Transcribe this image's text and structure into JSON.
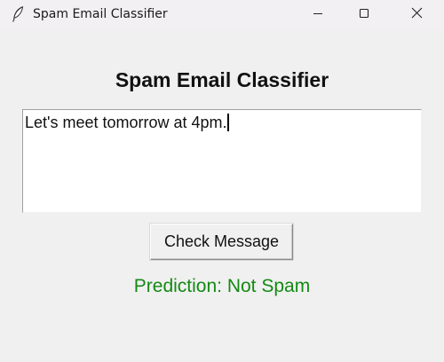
{
  "window": {
    "title": "Spam Email Classifier",
    "icon": "feather-icon",
    "controls": [
      "minimize-icon",
      "maximize-icon",
      "close-icon"
    ]
  },
  "main": {
    "heading": "Spam Email Classifier",
    "message_text": "Let's meet tomorrow at 4pm.",
    "check_button_label": "Check Message",
    "prediction_text": "Prediction: Not Spam",
    "prediction_color": "#138a13"
  }
}
